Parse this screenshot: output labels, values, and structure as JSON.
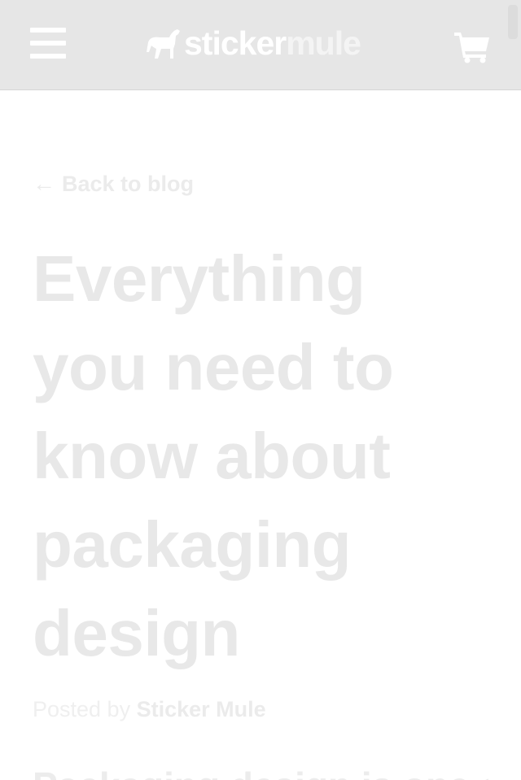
{
  "header": {
    "menu_icon": "hamburger-menu-icon",
    "logo": {
      "part1": "sticker",
      "part2": "mule",
      "icon": "horse-logo-icon"
    },
    "cart_icon": "shopping-cart-icon",
    "background": "#e6e6e6"
  },
  "article": {
    "back_arrow": "←",
    "back_label": "Back to blog",
    "title": "Everything you need to know about packaging design",
    "byline_prefix": "Posted by",
    "author": "Sticker Mule",
    "lead_partial": "Packaging design is one of t"
  }
}
